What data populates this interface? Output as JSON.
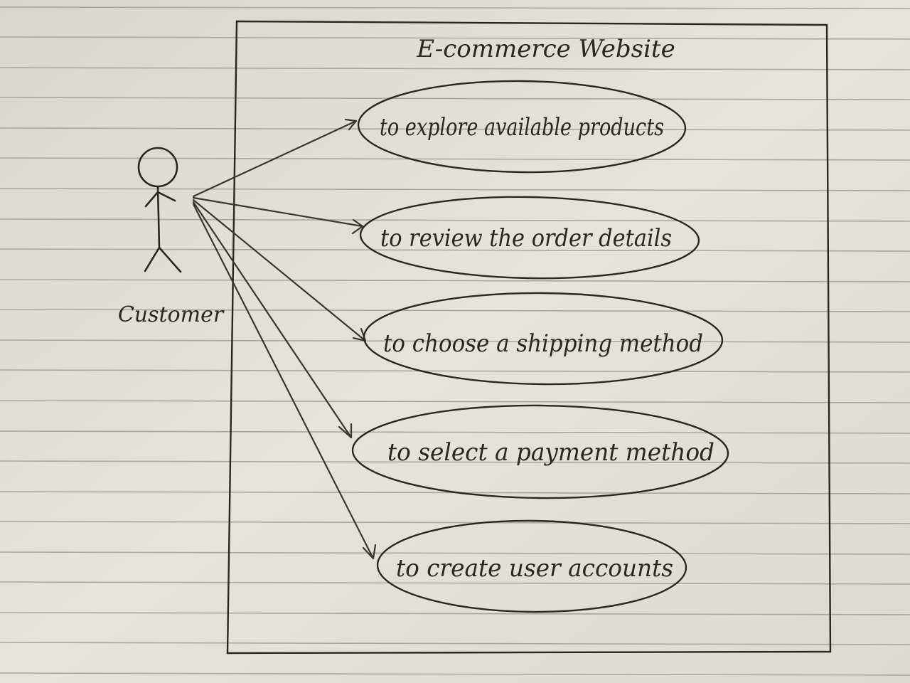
{
  "system": {
    "title": "E-commerce Website"
  },
  "actor": {
    "name": "Customer",
    "icon": "stick-figure-icon"
  },
  "use_cases": [
    {
      "label": "to explore available products"
    },
    {
      "label": "to review the order details"
    },
    {
      "label": "to choose a shipping method"
    },
    {
      "label": "to select a payment method"
    },
    {
      "label": "to create user accounts"
    }
  ],
  "colors": {
    "paper": "#e4e1da",
    "ruled_line": "#a9a7a6",
    "ink": "#2a2622"
  }
}
